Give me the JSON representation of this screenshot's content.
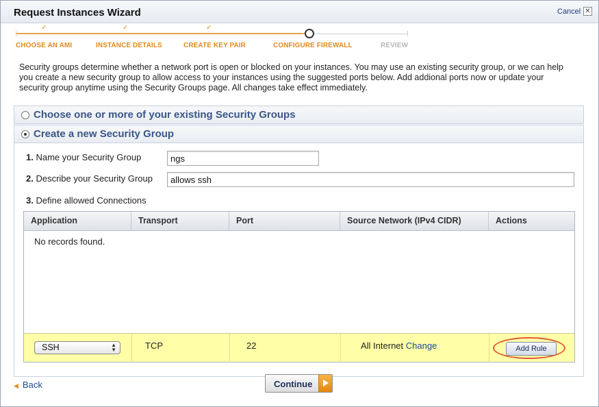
{
  "window": {
    "title": "Request Instances Wizard",
    "cancel_label": "Cancel",
    "close_glyph": "✕"
  },
  "steps": [
    {
      "label": "CHOOSE AN AMI",
      "state": "done",
      "check": "✓"
    },
    {
      "label": "INSTANCE DETAILS",
      "state": "done",
      "check": "✓"
    },
    {
      "label": "CREATE KEY PAIR",
      "state": "done",
      "check": "✓"
    },
    {
      "label": "CONFIGURE FIREWALL",
      "state": "current"
    },
    {
      "label": "REVIEW",
      "state": "pending"
    }
  ],
  "intro_text": "Security groups determine whether a network port is open or blocked on your instances. You may use an existing security group, or we can help you create a new security group to allow access to your instances using the suggested ports below. Add addional ports now or update your security group anytime using the Security Groups page. All changes take effect immediately.",
  "options": {
    "existing": {
      "label": "Choose one or more of your existing Security Groups",
      "selected": false
    },
    "create": {
      "label": "Create a new Security Group",
      "selected": true
    }
  },
  "form": {
    "name": {
      "num": "1.",
      "label": "Name your Security Group",
      "value": "ngs"
    },
    "describe": {
      "num": "2.",
      "label": "Describe your Security Group",
      "value": "allows ssh"
    },
    "define": {
      "num": "3.",
      "label": "Define allowed Connections"
    }
  },
  "grid": {
    "columns": [
      "Application",
      "Transport",
      "Port",
      "Source Network (IPv4 CIDR)",
      "Actions"
    ],
    "empty_text": "No records found.",
    "new_rule": {
      "application": "SSH",
      "transport": "TCP",
      "port": "22",
      "source": "All Internet",
      "change_label": "Change",
      "add_label": "Add Rule"
    }
  },
  "footer": {
    "back_label": "Back",
    "continue_label": "Continue"
  },
  "colors": {
    "accent_orange": "#e08a1e",
    "section_title_blue": "#3a5688",
    "new_rule_row": "#ffffa8",
    "highlight_red": "#e05a3a"
  }
}
